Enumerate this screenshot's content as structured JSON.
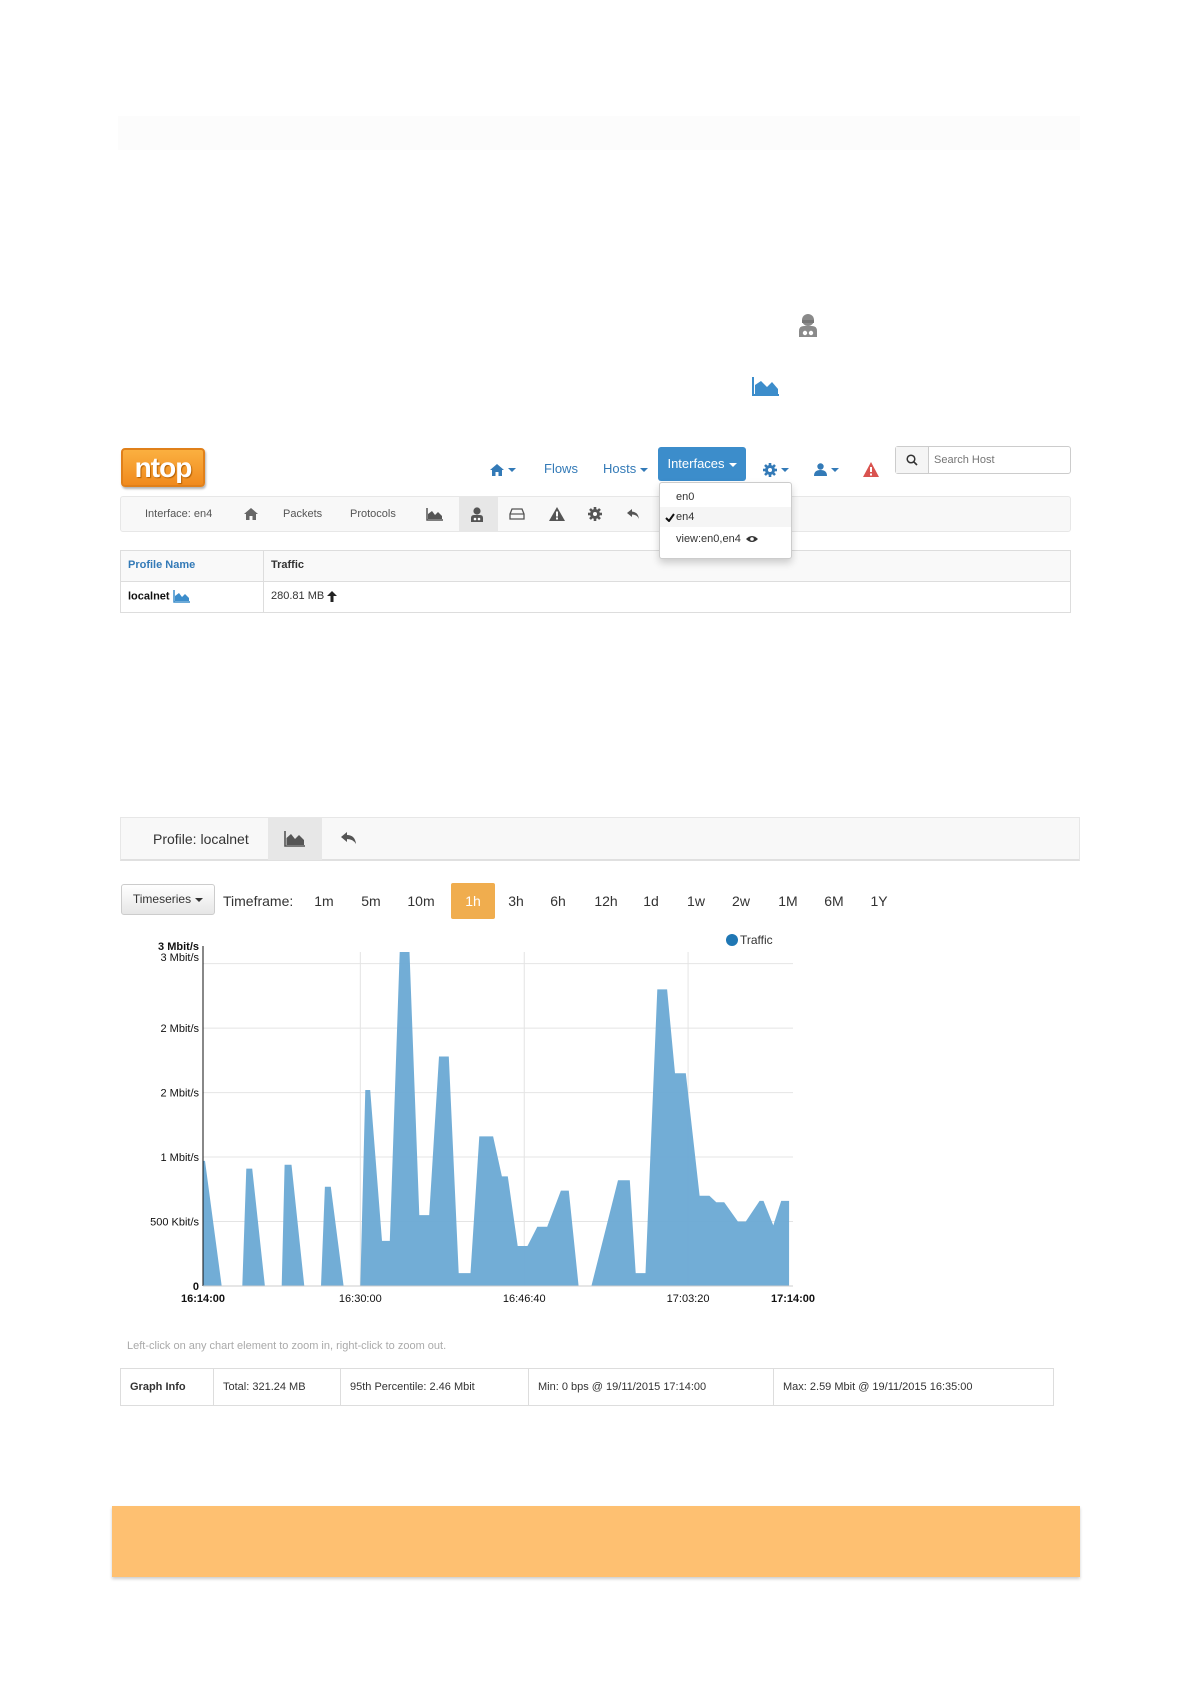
{
  "colors": {
    "brand": "#f5951f",
    "link": "#337ab7",
    "active_blue": "#3c8dcb",
    "chart_fill": "#6aa9d4",
    "alert_red": "#d9534f",
    "timeframe_active": "#f0ad4e"
  },
  "icons": {
    "profile_icon": "user-secret-icon",
    "chart_icon": "area-chart-icon"
  },
  "brand": {
    "logo_text": "ntop"
  },
  "navbar": {
    "flows": "Flows",
    "hosts": "Hosts",
    "interfaces": "Interfaces",
    "search_placeholder": "Search Host"
  },
  "interfaces_menu": {
    "items": [
      "en0",
      "en4",
      "view:en0,en4"
    ],
    "selected": "en4"
  },
  "subnav": {
    "interface_label": "Interface: en4",
    "packets": "Packets",
    "protocols": "Protocols"
  },
  "profiles_table": {
    "headers": [
      "Profile Name",
      "Traffic"
    ],
    "rows": [
      {
        "name": "localnet",
        "traffic": "280.81 MB"
      }
    ]
  },
  "profile_nav": {
    "label": "Profile: localnet"
  },
  "timeframe": {
    "timeseries_button": "Timeseries",
    "label": "Timeframe:",
    "options": [
      "1m",
      "5m",
      "10m",
      "1h",
      "3h",
      "6h",
      "12h",
      "1d",
      "1w",
      "2w",
      "1M",
      "6M",
      "1Y"
    ],
    "selected": "1h"
  },
  "chart_data": {
    "type": "area",
    "legend": [
      "Traffic"
    ],
    "legend_position": "top-right",
    "y_tick_labels": [
      "0",
      "500 Kbit/s",
      "1 Mbit/s",
      "2 Mbit/s",
      "2 Mbit/s",
      "3 Mbit/s",
      "3 Mbit/s"
    ],
    "y_tick_values": [
      0,
      0.5,
      1.0,
      1.5,
      2.0,
      2.5,
      2.59
    ],
    "x_tick_labels": [
      "16:14:00",
      "16:30:00",
      "16:46:40",
      "17:03:20",
      "17:14:00"
    ],
    "x_tick_minutes": [
      0,
      16,
      32.67,
      49.33,
      60
    ],
    "ylim": [
      0,
      2.59
    ],
    "grid": true,
    "unit": "Mbit/s",
    "series": [
      {
        "name": "Traffic",
        "x_minutes": [
          0,
          0.1,
          0.2,
          1.9,
          4,
          4.4,
          5,
          6.3,
          8,
          8.3,
          9,
          10.3,
          12,
          12.4,
          13,
          14.3,
          16,
          16.5,
          17,
          18.2,
          19,
          20,
          21,
          22,
          23,
          24,
          25,
          26,
          27.2,
          28.1,
          29.5,
          30.4,
          31,
          32,
          33,
          34,
          35,
          36.4,
          37.2,
          38.2,
          39.5,
          42.2,
          43.4,
          44,
          45,
          46.2,
          47.2,
          48,
          49.1,
          50.5,
          51.5,
          52.2,
          53,
          54.4,
          55.2,
          56.6,
          57,
          58,
          58.8,
          59.6
        ],
        "values": [
          0.97,
          0.97,
          0.97,
          0.0,
          0.0,
          0.91,
          0.91,
          0.0,
          0.0,
          0.94,
          0.94,
          0.0,
          0.0,
          0.77,
          0.77,
          0.0,
          0.0,
          1.52,
          1.52,
          0.35,
          0.35,
          2.59,
          2.59,
          0.55,
          0.55,
          1.78,
          1.78,
          0.1,
          0.1,
          1.16,
          1.16,
          0.85,
          0.85,
          0.31,
          0.31,
          0.46,
          0.46,
          0.74,
          0.74,
          0.0,
          0.0,
          0.82,
          0.82,
          0.1,
          0.1,
          2.3,
          2.3,
          1.65,
          1.65,
          0.7,
          0.7,
          0.65,
          0.65,
          0.5,
          0.5,
          0.66,
          0.66,
          0.47,
          0.66,
          0.66
        ]
      }
    ]
  },
  "hint": "Left-click on any chart element to zoom in, right-click to zoom out.",
  "graph_info": {
    "label": "Graph Info",
    "total": "Total: 321.24 MB",
    "percentile": "95th Percentile: 2.46 Mbit",
    "min": "Min: 0 bps @ 19/11/2015 17:14:00",
    "max": "Max: 2.59 Mbit @ 19/11/2015 16:35:00"
  }
}
